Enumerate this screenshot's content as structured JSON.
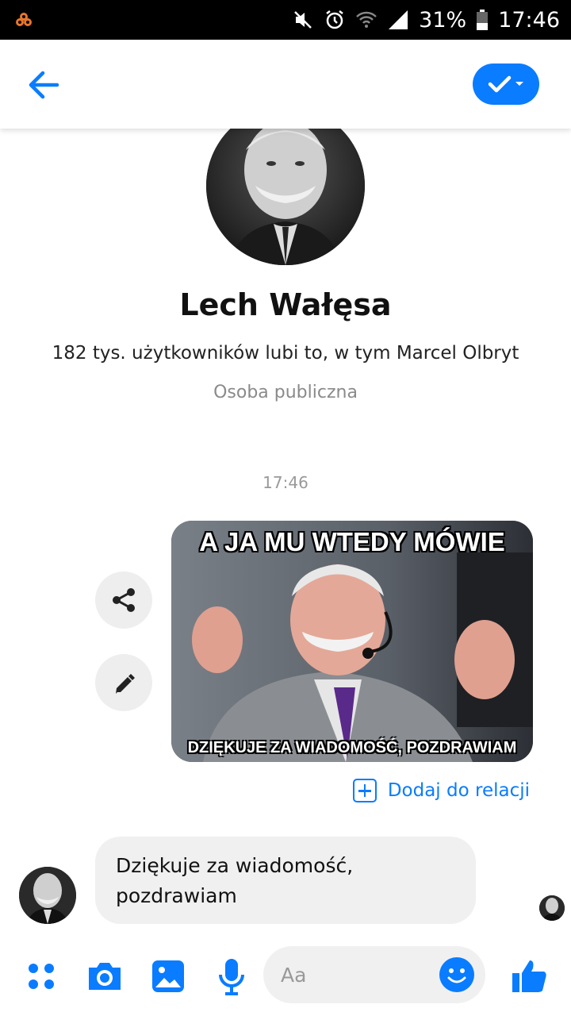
{
  "status_bar": {
    "battery": "31%",
    "time": "17:46"
  },
  "header": {
    "back_icon": "arrow-left-icon",
    "action_icon": "check-dropdown-icon",
    "accent_color": "#0a7cff"
  },
  "profile": {
    "name": "Lech Wałęsa",
    "likes": "182 tys. użytkowników lubi to, w tym Marcel Olbryt",
    "category": "Osoba publiczna"
  },
  "conversation": {
    "timestamp": "17:46",
    "meme": {
      "top_text": "A JA MU WTEDY MÓWIE",
      "bottom_text": "DZIĘKUJE ZA WIADOMOŚĆ, POZDRAWIAM"
    },
    "add_story_label": "Dodaj do relacji",
    "received_message": "Dziękuje za wiadomość, pozdrawiam"
  },
  "composer": {
    "placeholder": "Aa",
    "icons": [
      "more-icon",
      "camera-icon",
      "gallery-icon",
      "microphone-icon",
      "emoji-icon",
      "thumbs-up-icon"
    ]
  }
}
